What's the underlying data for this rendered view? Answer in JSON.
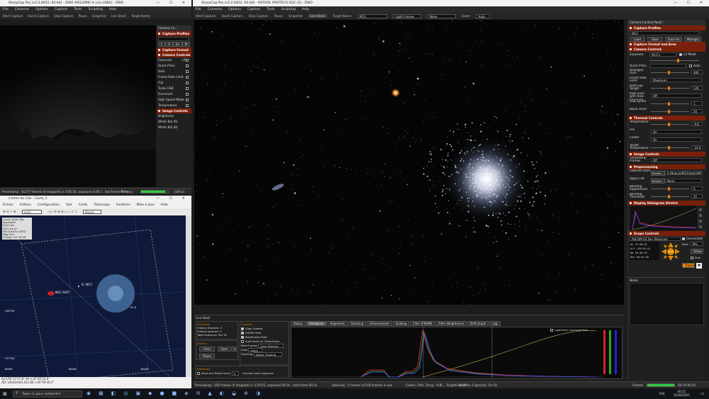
{
  "left_app": {
    "title": "SharpCap Pro (v3.2.6452, 64 bit) - ZWO ASI120MC-S (via USB2) - ZWO",
    "menu": [
      "File",
      "Cameras",
      "Options",
      "Capture",
      "Tools",
      "Scripting",
      "Help"
    ],
    "toolbar": [
      "Start Capture",
      "Quick Capture",
      "Stop Capture",
      "Pause",
      "Snapshot",
      "Live Stack",
      "Target Name"
    ],
    "panel_title": "Camera Co...",
    "sections": [
      "Capture Profiles",
      "Capture Format",
      "Camera Controls",
      "Image Controls"
    ],
    "controls": [
      "Exposure",
      "Quick Picks",
      "Gain",
      "Frame Rate Limit",
      "Flip",
      "Turbo USB",
      "Overclock",
      "High Speed Mode",
      "Temperature",
      "Brightness",
      "White Bal (R)",
      "White Bal (B)"
    ],
    "lx_label": "LX",
    "status_text": "Previewing : 61277 frames (0 dropped) in 3:05:35, exposure 0.05 s , last frame 7.7 s",
    "mem_label": "Memory",
    "mem_value": "3,8/4,0"
  },
  "cdc": {
    "title": "Cartes du Ciel - Carte_1",
    "menu": [
      "Fichier",
      "Edition",
      "Configuration",
      "Voir",
      "Carte",
      "Telescope",
      "Fenêtres",
      "Mise à jour",
      "Aide"
    ],
    "search_value": "m13",
    "info_lines": [
      "Coord. Alt/Az Téle",
      "Apparente",
      "Chez moi",
      "2021-04-15",
      "00h21m47s (CEST)",
      "Mag:18.0",
      "Champ:+31°18'18\""
    ],
    "labels": {
      "ngc": "NGC 6207",
      "ic": "IC 4617",
      "m13": "M 13"
    },
    "dec_labels": [
      "+36°00'",
      "+37°40'",
      "+35°20'"
    ],
    "ra_labels": [
      "16h50'",
      "16h40'",
      "16h30'"
    ],
    "zoom_option": "Heure",
    "coords": [
      "Az:178°17'17.8\"  Alt:+37°45'52.6\"",
      "AD: 16h42m43.42s  DE:+35°59'40.2\""
    ]
  },
  "main_app": {
    "title": "SharpCap Pro (v3.2.6452, 64 bit) - RATOOL PROTECH SQ2 (3) - ZWO",
    "menu": [
      "File",
      "Cameras",
      "Options",
      "Capture",
      "Tools",
      "Scripting",
      "Help"
    ],
    "toolbar": [
      "Start Capture",
      "Quick Capture",
      "Stop Capture",
      "Pause",
      "Snapshot",
      "Live Stack",
      "Target Name",
      "Zoom"
    ],
    "target_name": "M13",
    "frame_type": "Light Frames",
    "dark": "None",
    "zoom": "Auto",
    "live_stack": {
      "header": "Live Stack",
      "overview_title": "Overview",
      "frames_stacked": "Frames Stacked: 5",
      "frames_ignored": "Frames Ignored: 0",
      "total_exposure": "Total Exposure: 5m 0s",
      "actions_title": "Actions",
      "clear": "Clear",
      "save": "Save",
      "pause": "Pause",
      "controls_title": "Controls",
      "align_frames": "Align Frames",
      "fwhm_filter": "FWHM Filter",
      "brightness_filter": "Brightness Filter",
      "auto_save": "Auto Save on Clear/Close",
      "raw_frames_label": "Raw Frames",
      "raw_frames": "Save Stacked",
      "view_label": "View",
      "view": "Stack",
      "stacking_label": "Stacking",
      "stacking": "Sigma Clipping",
      "advanced_title": "Advanced",
      "save_reset": "Save and Reset every",
      "minutes": "minutes total exposure",
      "minutes_val": "5",
      "tabs": [
        "Status",
        "Histogram",
        "Alignment",
        "Stacking",
        "Enhancement",
        "Guiding",
        "Filter (FWHM)",
        "Filter (Brightness)",
        "Drift Graph",
        "Log"
      ],
      "active_tab": "Histogram",
      "hist_checkbox": "Logarithmic Horizontal Axis"
    },
    "status_text": "Previewing : 100 frames (0 dropped) in 2:16:55, exposure 60.0s , last frame 60.5s",
    "stack_status": "Stacking : 5 frames of 100 frames in use",
    "cooler_status": "Cooler: 14%,  Temp: -9.8C , Target: -10.0C",
    "stacked_status": "5 Stacked, 0 Ignored, 5m 0s",
    "frames_label": "Frames",
    "frames_value": "00:10:00.41"
  },
  "right_panel": {
    "title": "Camera Control Panel",
    "sections": [
      "Capture Profiles",
      "Capture Format and Area",
      "Camera Controls",
      "Thermal Controls",
      "Image Controls",
      "Preprocessing",
      "Display Histogram Stretch",
      "Scope Controls"
    ],
    "profile_value": "M13",
    "profile_buttons": [
      "Load",
      "Save",
      "Save As...",
      "Manage..."
    ],
    "exposure_value": "60.0 s",
    "lx_mode": "LX Mode",
    "quick_picks": "Quick Picks",
    "auto": "Auto",
    "controls": [
      {
        "label": "Analogue Gain",
        "value": "400"
      },
      {
        "label": "Frame Rate Limit",
        "value": "Maximum"
      },
      {
        "label": "Auto Exp Target",
        "value": "120"
      },
      {
        "label": "Auto Gain with Auto Exposure",
        "value": "Off"
      },
      {
        "label": "USB Speed",
        "value": "1"
      },
      {
        "label": "Black Level",
        "value": "50"
      }
    ],
    "thermal": [
      {
        "label": "Temperature",
        "value": "-9.8"
      },
      {
        "label": "Fan",
        "value": "On"
      },
      {
        "label": "Cooler",
        "value": "On"
      },
      {
        "label": "Target Temperature",
        "value": "-10.0"
      }
    ],
    "image": [
      {
        "label": "Timestamp Frames",
        "value": "Off"
      }
    ],
    "pre": [
      {
        "label": "Subtract Dark",
        "value": "E:\\Nebula\\M13\\darks\\MASTER"
      },
      {
        "label": "Apply Flat",
        "value": "None"
      },
      {
        "label": "Banding Suppression",
        "value": "0"
      },
      {
        "label": "Banding Threshold",
        "value": "35"
      }
    ],
    "browse": "Browse...",
    "scope_name": "ASCOM G2 Sky Telescope",
    "connected": "Connected",
    "az": "Az  75:40:22",
    "alt": "Alt  +39:54:41",
    "ra": "RA  16:40:23",
    "dec": "Dec  36:32:09",
    "rate_label": "Rate",
    "rate_value": "Ma..",
    "setup": "Setup",
    "park": "Park",
    "tracking": "Tracking",
    "stop": "STOP",
    "notes": "Notes"
  },
  "taskbar": {
    "search": "Taper ici pour rechercher",
    "lang": "FRA",
    "time": "00:21",
    "date": "15/04/2021"
  }
}
